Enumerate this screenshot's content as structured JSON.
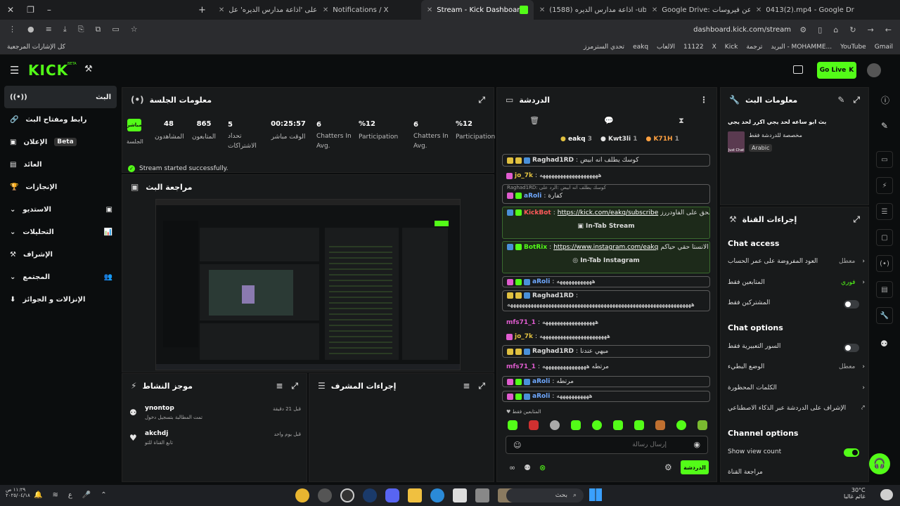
{
  "browser": {
    "tabs": [
      {
        "title": "اعتر على 'اذاعة مدارس الديره' عل",
        "color": "#ffffff"
      },
      {
        "title": "Notifications / X",
        "color": "#ffffff"
      },
      {
        "title": "Stream - Kick Dashboard",
        "color": "#53fc18"
      },
      {
        "title": "(1588) اذاعة مدارس الديره -ube",
        "color": "#ff0000"
      },
      {
        "title": "Google Drive: بحثًا عن فيروسات",
        "color": "#34a853"
      },
      {
        "title": "0413(2).mp4 - Google Drive",
        "color": "#4285f4"
      }
    ],
    "url": "dashboard.kick.com/stream",
    "bookmarks": [
      "Gmail",
      "YouTube",
      "البريد - MOHAMME...",
      "ترجمة",
      "Kick",
      "X",
      "11122",
      "الالعاب",
      "eakq",
      "تحدي السترمرز"
    ],
    "bookmarks_all": "كل الإشارات المرجعية"
  },
  "top": {
    "logo": "KICK",
    "beta": "BETA",
    "go_live": "Go Live"
  },
  "sidebar": {
    "items": [
      {
        "label": "البث",
        "icon": "broadcast-icon"
      },
      {
        "label": "رابط ومفتاح البث",
        "icon": "link-icon"
      },
      {
        "label": "الإعلان",
        "badge": "Beta",
        "icon": "ad-icon"
      },
      {
        "label": "العائد",
        "icon": "wallet-icon"
      },
      {
        "label": "الإنجازات",
        "icon": "trophy-icon"
      },
      {
        "label": "الاستديو",
        "icon": "studio-icon"
      },
      {
        "label": "التحليلات",
        "icon": "chart-icon"
      },
      {
        "label": "الإشراف",
        "icon": "hammer-icon"
      },
      {
        "label": "المجتمع",
        "icon": "community-icon"
      },
      {
        "label": "الإنزالات و الجوائز",
        "icon": "drops-icon"
      }
    ]
  },
  "session": {
    "title": "معلومات الجلسة",
    "live_badge": "مباشر",
    "live_label": "الجلسة",
    "stats": [
      {
        "value": "48",
        "label": "المشاهدون"
      },
      {
        "value": "865",
        "label": "المتابعون"
      },
      {
        "value": "5",
        "label": "تحداد الاشتراكات"
      },
      {
        "value": "00:25:57",
        "label": "الوقت مباشر"
      },
      {
        "value": "6",
        "label": "Chatters In Avg."
      },
      {
        "value": "%12",
        "label": "Participation"
      },
      {
        "value": "6",
        "label": "Chatters In Avg."
      },
      {
        "value": "%12",
        "label": "Participation"
      }
    ],
    "status": "Stream started successfully."
  },
  "preview": {
    "title": "مراجعة البث"
  },
  "activity": {
    "title": "موجز النشاط",
    "items": [
      {
        "user": "ynontop",
        "action": "تمت المطالبة بتسجيل دخول",
        "time": "قبل 21 دقيقة"
      },
      {
        "user": "akchdj",
        "action": "تابع القناة للتو",
        "time": "قبل يوم واحد"
      }
    ]
  },
  "mod_actions": {
    "title": "إجراءات المشرف"
  },
  "chat": {
    "title": "الدردشة",
    "top": [
      {
        "name": "eakq",
        "count": "3"
      },
      {
        "name": "Kwt3li",
        "count": "1"
      },
      {
        "name": "K71H",
        "count": "1"
      }
    ],
    "messages": [
      {
        "user": "Raghad1RD",
        "text": "كوسك يطلف انه ابيض",
        "color": "#ffffff"
      },
      {
        "user": "jo_7k",
        "text": "ههههههههههههههههههههه",
        "color": "#e0c040"
      },
      {
        "user": "aRoli",
        "text": "كفارة",
        "reply": "Raghad1RD: كوسك يطلف انه ابيض :الرد على",
        "color": "#6fa8ff"
      },
      {
        "user": "KickBot",
        "text": "الحق على الفاودررز",
        "link": "https://kick.com/eakq/subscribe",
        "button": "In-Tab Stream",
        "color": "#ff5a5a"
      },
      {
        "user": "BotRix",
        "text": "الانستا حقي حياكم",
        "link": "https://www.instagram.com/eakq",
        "button": "In-Tab Instagram",
        "color": "#53fc18"
      },
      {
        "user": "aRoli",
        "text": "ههههههههههههه",
        "color": "#6fa8ff"
      },
      {
        "user": "Raghad1RD",
        "text": "هههههههههههههههههههههههههههههههههههههههههههههههههههههههههههههههه",
        "color": "#ffffff"
      },
      {
        "user": "mfs71_1",
        "text": "ههههههههههههههههههه",
        "color": "#e05ccf"
      },
      {
        "user": "jo_7k",
        "text": "هههههههههههههههههههههههه",
        "color": "#e0c040"
      },
      {
        "user": "Raghad1RD",
        "text": "ميهي عندنا",
        "color": "#ffffff"
      },
      {
        "user": "mfs71_1",
        "text": "مرتطه هههههههههههههههه",
        "color": "#e05ccf"
      },
      {
        "user": "aRoli",
        "text": "مرتطه",
        "color": "#6fa8ff"
      },
      {
        "user": "aRoli",
        "text": "هههههههههههه",
        "color": "#6fa8ff"
      }
    ],
    "followers_only": "المتابعين فقط",
    "input_placeholder": "إرسال رسالة",
    "send": "الدردشة"
  },
  "stream_info": {
    "title": "معلومات البث",
    "stream_title": "بث ابو ساعه لحد يجي اكرر لحد يجي",
    "category": "مخصصة للدردشة فقط",
    "thumb_label": "Just Chat",
    "language": "Arabic"
  },
  "channel_actions": {
    "title": "إجراءات القناة",
    "chat_access": "Chat access",
    "access_rows": [
      {
        "label": "العود المفروضة على عمر الحساب",
        "value": "معطل"
      },
      {
        "label": "المتابعين فقط",
        "value": "فوري"
      },
      {
        "label": "المشتركين فقط",
        "value": ""
      }
    ],
    "chat_options": "Chat options",
    "option_rows": [
      {
        "label": "السور التعبيرية فقط",
        "value": ""
      },
      {
        "label": "الوضع البطيء",
        "value": "معطل"
      },
      {
        "label": "الكلمات المحظورة",
        "value": ""
      },
      {
        "label": "الإشراف على الدردشة عبر الذكاء الاصطناعي",
        "value": ""
      }
    ],
    "channel_options": "Channel options",
    "show_view_count": "Show view count",
    "channel_review": "مراجعة القناة"
  },
  "taskbar": {
    "search": "بحث",
    "time": "١١:٢٩ ص",
    "date": "٢٠٢٥/٠٤/١٨",
    "weather_temp": "30°C",
    "weather_text": "غائم غالبا"
  },
  "colors": {
    "accent": "#53fc18",
    "bg": "#0b0d0e",
    "panel": "#181a1b"
  }
}
